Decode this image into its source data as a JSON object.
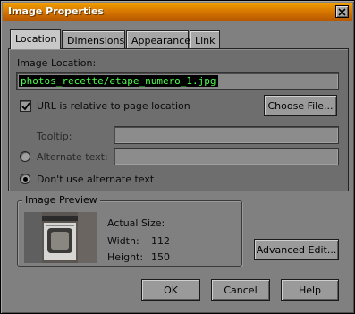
{
  "window": {
    "title": "Image Properties"
  },
  "tabs": [
    {
      "label": "Location"
    },
    {
      "label": "Dimensions"
    },
    {
      "label": "Appearance"
    },
    {
      "label": "Link"
    }
  ],
  "location": {
    "image_location_label": "Image Location:",
    "image_location_value": "photos_recette/etape_numero_1.jpg",
    "relative_checkbox_label": "URL is relative to page location",
    "relative_checked": true,
    "choose_file_label": "Choose File...",
    "tooltip_label": "Tooltip:",
    "tooltip_value": "",
    "alt_text_label": "Alternate text:",
    "alt_text_value": "",
    "no_alt_label": "Don't use alternate text",
    "selected_option": "no_alt"
  },
  "preview": {
    "title": "Image Preview",
    "actual_size_label": "Actual Size:",
    "width_label": "Width:",
    "width_value": "112",
    "height_label": "Height:",
    "height_value": "150"
  },
  "buttons": {
    "advanced_edit": "Advanced Edit...",
    "ok": "OK",
    "cancel": "Cancel",
    "help": "Help"
  },
  "colors": {
    "title_bar": "#d87a00",
    "selection_text": "#4dff4d",
    "selection_bg": "#000000"
  }
}
